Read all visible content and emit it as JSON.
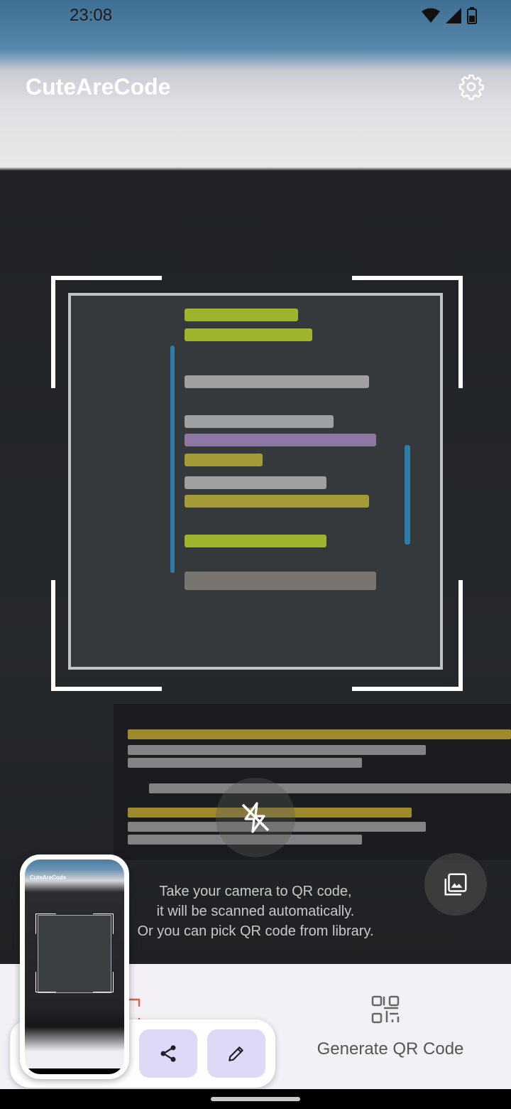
{
  "status_bar": {
    "time": "23:08"
  },
  "app_bar": {
    "title": "CuteAreCode",
    "settings_icon": "gear-icon"
  },
  "scanner": {
    "flash_icon": "flash-off-icon",
    "gallery_icon": "image-gallery-icon",
    "instructions": [
      "Take your camera to QR code,",
      "it will be scanned automatically.",
      "Or you can pick QR code from library."
    ]
  },
  "bottom_nav": {
    "items": [
      {
        "label": "Generate QR Code",
        "icon": "qr-code-icon"
      }
    ]
  },
  "screenshot_preview": {
    "thumbnail_title": "CuteAreCode",
    "share_icon": "share-icon",
    "edit_icon": "pencil-edit-icon"
  },
  "colors": {
    "overlay_frame": "#ffffff",
    "nav_background": "#f3f1f6",
    "preview_button": "#dcdaf6",
    "instruction_text": "#c9c9c9"
  }
}
